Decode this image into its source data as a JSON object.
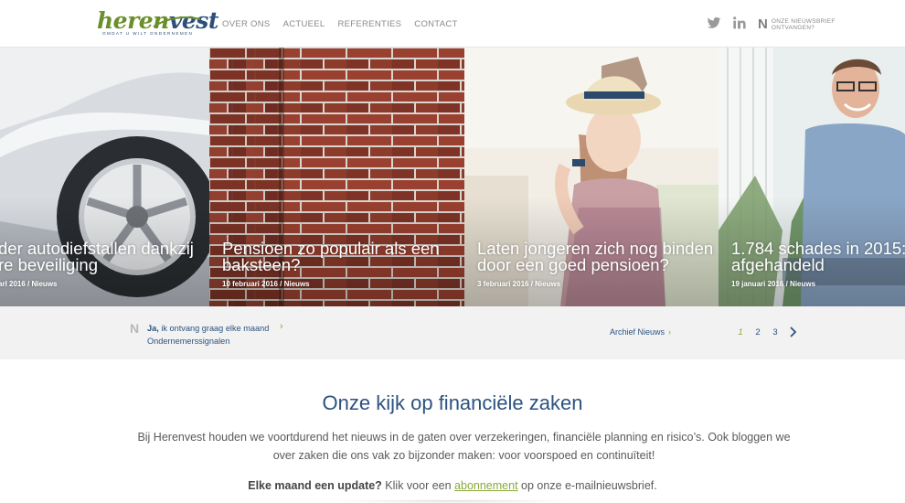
{
  "logo": {
    "word_part1": "heren",
    "word_part2": "vest",
    "tagline": "OMDAT U WILT ONDERNEMEN"
  },
  "nav": {
    "items": [
      {
        "label": "OVER ONS"
      },
      {
        "label": "ACTUEEL"
      },
      {
        "label": "REFERENTIES"
      },
      {
        "label": "CONTACT"
      }
    ]
  },
  "header_right": {
    "twitter_icon": "twitter-icon",
    "linkedin_icon": "linkedin-icon",
    "newsletter_letter": "N",
    "newsletter_label": "ONZE NIEUWSBRIEF ONTVANGEN?"
  },
  "slides": [
    {
      "title_line1": "der autodiefstallen dankzij",
      "title_line2": "re beveiliging",
      "date": "arl 2016",
      "sep": " / ",
      "category": "Nieuws"
    },
    {
      "title_line1": "Pensioen zo populair als een",
      "title_line2": "baksteen?",
      "date": "10 februari 2016",
      "sep": " / ",
      "category": "Nieuws"
    },
    {
      "title_line1": "Laten jongeren zich nog binden",
      "title_line2": "door een goed pensioen?",
      "date": "3 februari 2016",
      "sep": " / ",
      "category": "Nieuws"
    },
    {
      "title_line1": "1.784 schades in 2015: v",
      "title_line2": "afgehandeld",
      "date": "19 januari 2016",
      "sep": " / ",
      "category": "Nieuws"
    }
  ],
  "subscribe": {
    "letter": "N",
    "bold": "Ja,",
    "line1": " ik ontvang graag elke maand",
    "line2": "Ondernemerssignalen",
    "arrow": "›"
  },
  "archive": {
    "label": "Archief Nieuws",
    "arrow": "›"
  },
  "pager": {
    "pages": [
      "1",
      "2",
      "3"
    ],
    "active": "1"
  },
  "intro": {
    "title": "Onze kijk op financiële zaken",
    "text": "Bij Herenvest houden we voortdurend het nieuws in de gaten over verzekeringen, financiële planning en risico’s. Ook bloggen we over zaken die ons vak zo bijzonder maken: voor voorspoed en continuïteit!",
    "cta_bold": "Elke maand een update?",
    "cta_pre": " Klik voor een ",
    "cta_link": "abonnement",
    "cta_post": " op onze e-mailnieuwsbrief."
  },
  "colors": {
    "brand_blue": "#2c5280",
    "brand_green": "#8aaa3a",
    "infobar_bg": "#f2f2f2"
  }
}
